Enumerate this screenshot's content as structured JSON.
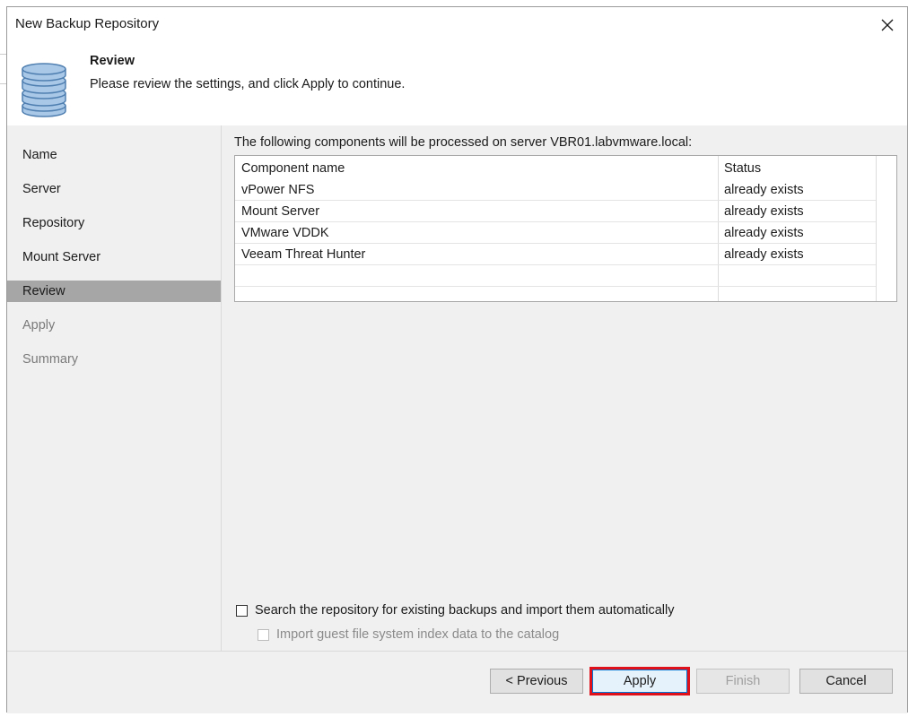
{
  "window": {
    "title": "New Backup Repository",
    "close_icon": "close-icon"
  },
  "header": {
    "icon": "database-icon",
    "title": "Review",
    "subtitle": "Please review the settings, and click Apply to continue."
  },
  "sidebar": {
    "items": [
      {
        "label": "Name",
        "state": "normal"
      },
      {
        "label": "Server",
        "state": "normal"
      },
      {
        "label": "Repository",
        "state": "normal"
      },
      {
        "label": "Mount Server",
        "state": "normal"
      },
      {
        "label": "Review",
        "state": "active"
      },
      {
        "label": "Apply",
        "state": "disabled"
      },
      {
        "label": "Summary",
        "state": "disabled"
      }
    ]
  },
  "main": {
    "intro": "The following components will be processed on server VBR01.labvmware.local:",
    "table": {
      "headers": {
        "name": "Component name",
        "status": "Status"
      },
      "rows": [
        {
          "name": "vPower NFS",
          "status": "already exists"
        },
        {
          "name": "Mount Server",
          "status": "already exists"
        },
        {
          "name": "VMware VDDK",
          "status": "already exists"
        },
        {
          "name": "Veeam Threat Hunter",
          "status": "already exists"
        }
      ]
    },
    "options": {
      "search_label": "Search the repository for existing backups and import them automatically",
      "search_checked": false,
      "index_label": "Import guest file system index data to the catalog",
      "index_checked": false
    }
  },
  "footer": {
    "previous_label": "< Previous",
    "apply_label": "Apply",
    "finish_label": "Finish",
    "cancel_label": "Cancel"
  },
  "colors": {
    "sidebar_active": "#a6a6a6",
    "highlight_border": "#e0101b",
    "focus_blue": "#0078d7"
  }
}
